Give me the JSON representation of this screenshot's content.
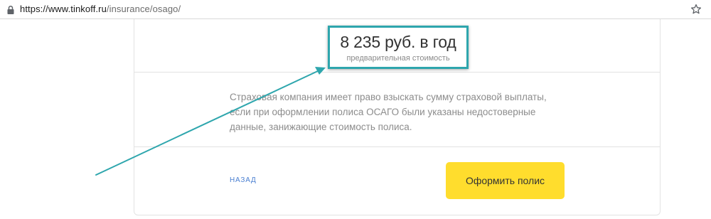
{
  "browser": {
    "url_host": "https://www.tinkoff.ru",
    "url_path": "/insurance/osago/",
    "lock_icon": "lock-icon",
    "bookmark_icon": "star-icon"
  },
  "price": {
    "value": "8 235 руб. в год",
    "caption": "предварительная стоимость",
    "highlight_color": "#2ea6ad"
  },
  "disclaimer": {
    "text": "Страховая компания имеет право взыскать сумму страховой выплаты, если при оформлении полиса ОСАГО были указаны недостоверные данные, занижающие стоимость полиса."
  },
  "actions": {
    "back_label": "НАЗАД",
    "submit_label": "Оформить полис",
    "submit_color": "#ffdd2d"
  },
  "annotation": {
    "arrow_color": "#2ea6ad"
  }
}
